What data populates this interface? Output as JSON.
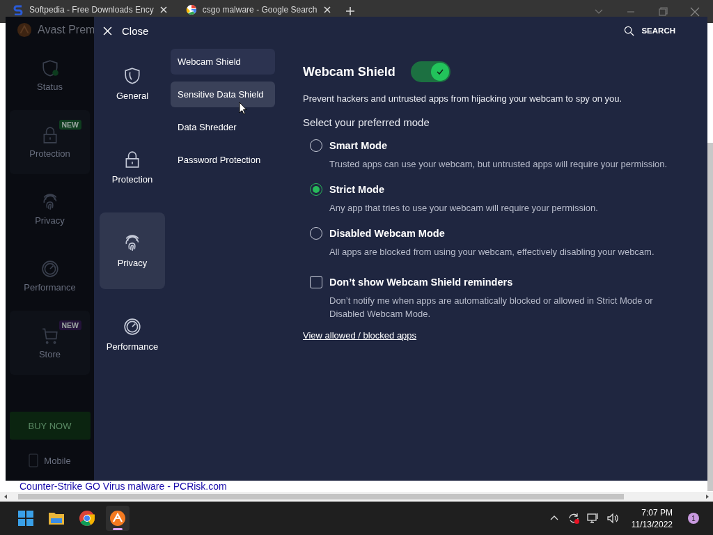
{
  "browser": {
    "tabs": [
      {
        "title": "Softpedia - Free Downloads Ency"
      },
      {
        "title": "csgo malware - Google Search"
      }
    ],
    "page_link": "Counter-Strike GO Virus malware - PCRisk.com"
  },
  "app": {
    "title": "Avast Prem",
    "nav": [
      {
        "label": "Status"
      },
      {
        "label": "Protection",
        "badge": {
          "text": "NEW",
          "color": "#0f3d1f"
        }
      },
      {
        "label": "Privacy"
      },
      {
        "label": "Performance"
      },
      {
        "label": "Store",
        "badge": {
          "text": "NEW",
          "color": "#24133a"
        }
      }
    ],
    "buy_button": "BUY NOW",
    "mobile": "Mobile"
  },
  "settings": {
    "close_label": "Close",
    "search_label": "SEARCH",
    "categories": [
      {
        "label": "General",
        "selected": false
      },
      {
        "label": "Protection",
        "selected": false
      },
      {
        "label": "Privacy",
        "selected": true
      },
      {
        "label": "Performance",
        "selected": false
      }
    ],
    "submenu": [
      {
        "label": "Webcam Shield",
        "selected": true,
        "hovered": false
      },
      {
        "label": "Sensitive Data Shield",
        "selected": false,
        "hovered": true
      },
      {
        "label": "Data Shredder",
        "selected": false,
        "hovered": false
      },
      {
        "label": "Password Protection",
        "selected": false,
        "hovered": false
      }
    ],
    "content": {
      "title": "Webcam Shield",
      "toggle_on": true,
      "description": "Prevent hackers and untrusted apps from hijacking your webcam to spy on you.",
      "mode_heading": "Select your preferred mode",
      "modes": [
        {
          "label": "Smart Mode",
          "description": "Trusted apps can use your webcam, but untrusted apps will require your permission.",
          "selected": false
        },
        {
          "label": "Strict Mode",
          "description": "Any app that tries to use your webcam will require your permission.",
          "selected": true
        },
        {
          "label": "Disabled Webcam Mode",
          "description": "All apps are blocked from using your webcam, effectively disabling your webcam.",
          "selected": false
        }
      ],
      "reminder": {
        "label": "Don’t show Webcam Shield reminders",
        "description": "Don’t notify me when apps are automatically blocked or allowed in Strict Mode or Disabled Webcam Mode.",
        "checked": false
      },
      "link": "View allowed / blocked apps"
    }
  },
  "taskbar": {
    "apps": [
      {
        "kind": "windows",
        "active": false
      },
      {
        "kind": "folder",
        "active": false
      },
      {
        "kind": "chrome",
        "active": false
      },
      {
        "kind": "avast",
        "active": true
      }
    ],
    "time": "7:07 PM",
    "date": "11/13/2022",
    "notifications": "1"
  }
}
